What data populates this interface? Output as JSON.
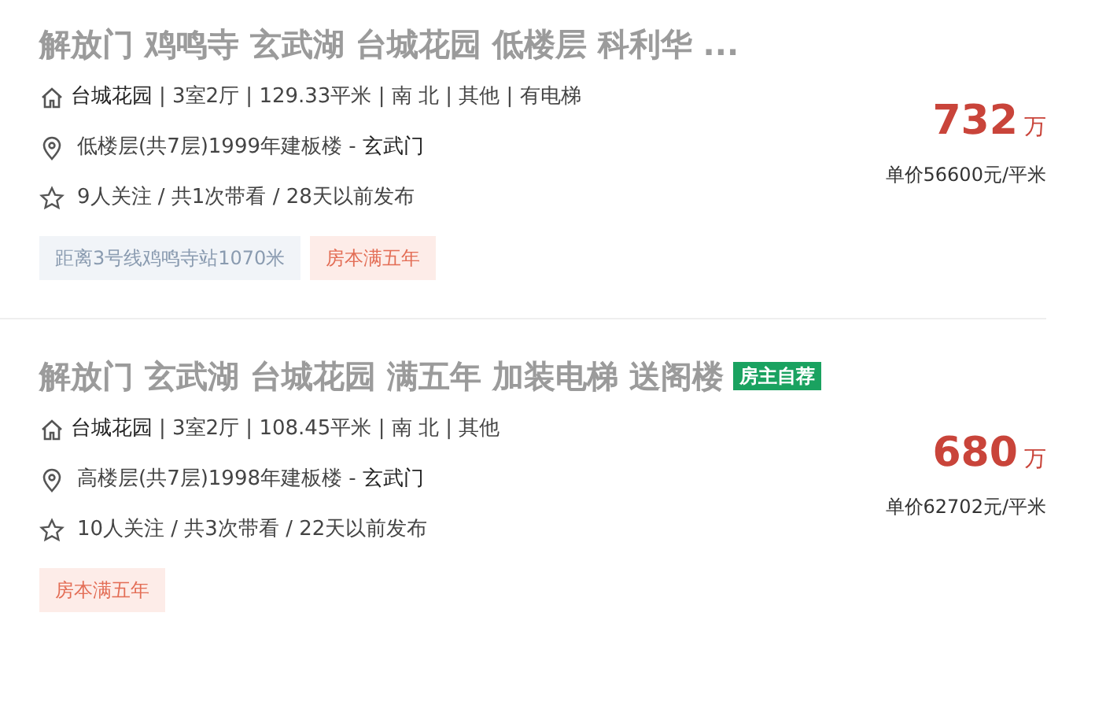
{
  "listings": [
    {
      "title": "解放门 鸡鸣寺 玄武湖 台城花园 低楼层 科利华 ...",
      "community": "台城花园",
      "details": "| 3室2厅 | 129.33平米 | 南 北 | 其他 | 有电梯",
      "floor": "低楼层(共7层)1999年建板楼 -",
      "area": "玄武门",
      "follow": "9人关注 / 共1次带看 / 28天以前发布",
      "tags": [
        {
          "kind": "subway",
          "label": "距离3号线鸡鸣寺站1070米"
        },
        {
          "kind": "taxfree",
          "label": "房本满五年"
        }
      ],
      "price": "732",
      "price_unit": "万",
      "unit_price": "单价56600元/平米"
    },
    {
      "title": "解放门 玄武湖 台城花园 满五年 加装电梯 送阁楼",
      "badge": "房主自荐",
      "community": "台城花园",
      "details": "| 3室2厅 | 108.45平米 | 南 北 | 其他",
      "floor": "高楼层(共7层)1998年建板楼 -",
      "area": "玄武门",
      "follow": "10人关注 / 共3次带看 / 22天以前发布",
      "tags": [
        {
          "kind": "taxfree",
          "label": "房本满五年"
        }
      ],
      "price": "680",
      "price_unit": "万",
      "unit_price": "单价62702元/平米"
    }
  ]
}
